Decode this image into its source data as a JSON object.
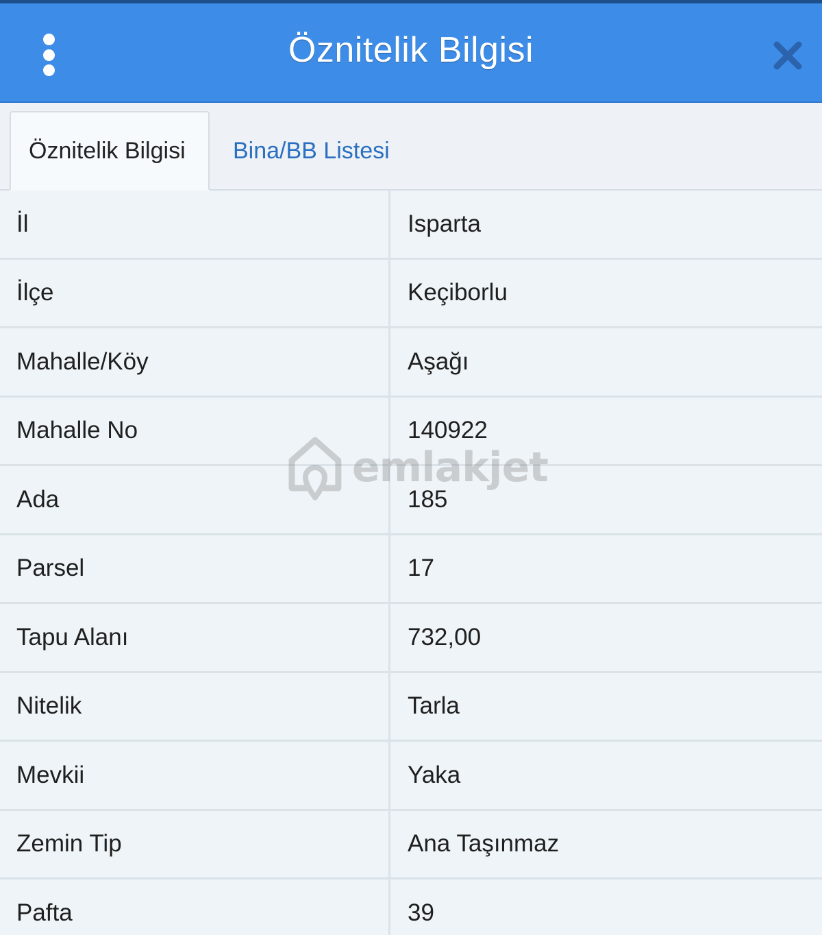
{
  "header": {
    "title": "Öznitelik Bilgisi",
    "menu_icon": "vertical-dots-icon",
    "close_icon": "close-icon",
    "accent_color": "#3d8de8"
  },
  "tabs": [
    {
      "label": "Öznitelik Bilgisi",
      "active": true
    },
    {
      "label": "Bina/BB Listesi",
      "active": false
    }
  ],
  "rows": [
    {
      "key": "İl",
      "value": "Isparta"
    },
    {
      "key": "İlçe",
      "value": "Keçiborlu"
    },
    {
      "key": "Mahalle/Köy",
      "value": "Aşağı"
    },
    {
      "key": "Mahalle No",
      "value": "140922"
    },
    {
      "key": "Ada",
      "value": "185"
    },
    {
      "key": "Parsel",
      "value": "17"
    },
    {
      "key": "Tapu Alanı",
      "value": "732,00"
    },
    {
      "key": "Nitelik",
      "value": "Tarla"
    },
    {
      "key": "Mevkii",
      "value": "Yaka"
    },
    {
      "key": "Zemin Tip",
      "value": "Ana Taşınmaz"
    },
    {
      "key": "Pafta",
      "value": "39"
    }
  ],
  "watermark": {
    "text": "emlakjet",
    "icon": "house-pin-logo-icon"
  }
}
